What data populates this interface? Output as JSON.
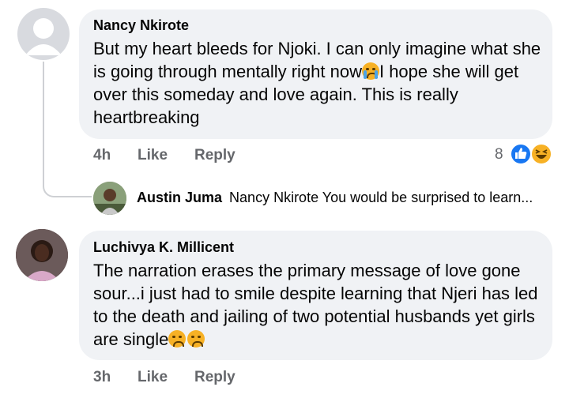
{
  "comments": [
    {
      "author": "Nancy Nkirote",
      "text_before_emoji": "But my heart bleeds for Njoki. I can only imagine what she is going through mentally right now",
      "text_after_emoji": "I hope she will get over this someday and love again. This is really heartbreaking",
      "time": "4h",
      "like_label": "Like",
      "reply_label": "Reply",
      "reaction_count": "8",
      "inline_emoji_icon": "loudly-crying-face-icon",
      "reaction_icons": [
        "like-reaction-icon",
        "haha-reaction-icon"
      ],
      "colors": {
        "like": "#1877f2",
        "haha": "#f7b125"
      }
    },
    {
      "author": "Luchivya K. Millicent",
      "text": "The narration erases the primary message  of love gone sour...i just had to smile despite learning that Njeri has led to the death and jailing of two potential husbands yet girls are single",
      "trailing_emoji_icons": [
        "worried-face-icon",
        "worried-face-icon"
      ],
      "time": "3h",
      "like_label": "Like",
      "reply_label": "Reply"
    }
  ],
  "reply_preview": {
    "author": "Austin Juma",
    "text": "Nancy Nkirote You would be surprised to learn..."
  }
}
